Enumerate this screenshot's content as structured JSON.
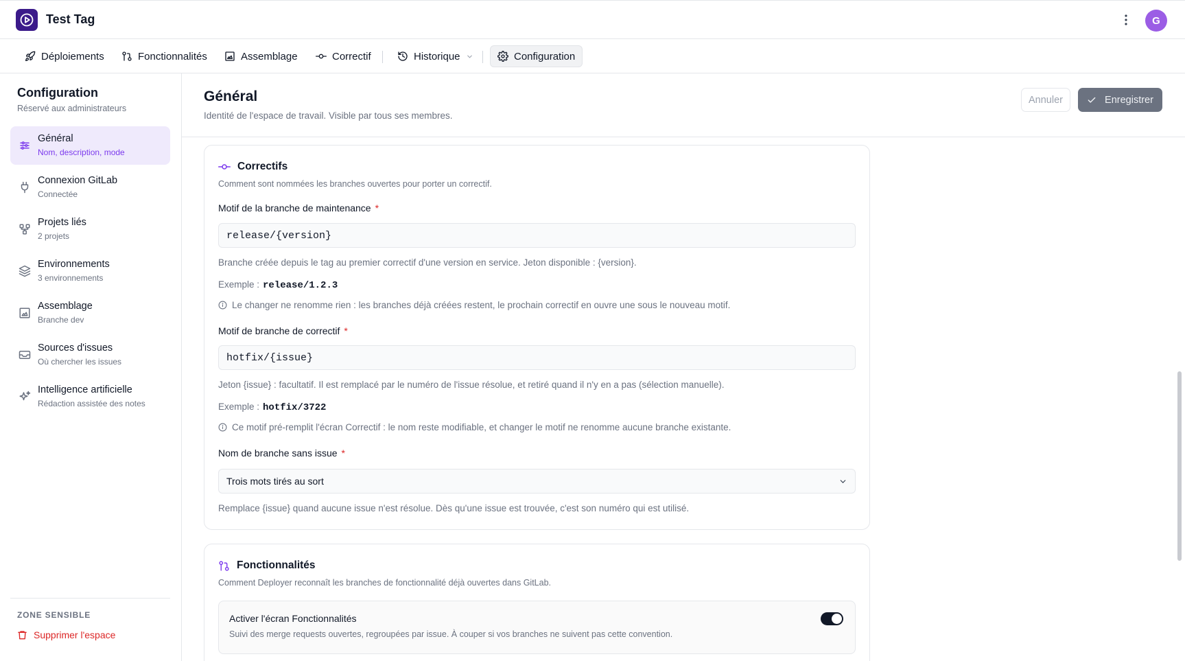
{
  "app": {
    "title": "Test Tag"
  },
  "user": {
    "avatar_initial": "G",
    "avatar_color": "#9b5de5"
  },
  "nav": {
    "tabs": [
      {
        "label": "Déploiements",
        "icon": "rocket-icon"
      },
      {
        "label": "Fonctionnalités",
        "icon": "git-pull-request-icon"
      },
      {
        "label": "Assemblage",
        "icon": "frame-icon"
      },
      {
        "label": "Correctif",
        "icon": "git-commit-icon"
      },
      {
        "label": "Historique",
        "icon": "history-icon"
      },
      {
        "label": "Configuration",
        "icon": "gear-icon",
        "active": true
      }
    ]
  },
  "sidebar": {
    "title": "Configuration",
    "subtitle": "Réservé aux administrateurs",
    "items": [
      {
        "label": "Général",
        "desc": "Nom, description, mode",
        "icon": "sliders-icon",
        "active": true
      },
      {
        "label": "Connexion GitLab",
        "desc": "Connectée",
        "icon": "plug-icon"
      },
      {
        "label": "Projets liés",
        "desc": "2 projets",
        "icon": "projects-icon"
      },
      {
        "label": "Environnements",
        "desc": "3 environnements",
        "icon": "layers-icon"
      },
      {
        "label": "Assemblage",
        "desc": "Branche dev",
        "icon": "frame-icon"
      },
      {
        "label": "Sources d'issues",
        "desc": "Où chercher les issues",
        "icon": "inbox-icon"
      },
      {
        "label": "Intelligence artificielle",
        "desc": "Rédaction assistée des notes",
        "icon": "sparkles-icon"
      }
    ],
    "danger": {
      "title": "ZONE SENSIBLE",
      "action": "Supprimer l'espace"
    }
  },
  "main": {
    "title": "Général",
    "subtitle": "Identité de l'espace de travail. Visible par tous ses membres.",
    "cancel_label": "Annuler",
    "save_label": "Enregistrer"
  },
  "correctifs": {
    "title": "Correctifs",
    "desc": "Comment sont nommées les branches ouvertes pour porter un correctif.",
    "maintenance": {
      "label": "Motif de la branche de maintenance",
      "required": "*",
      "value": "release/{version}",
      "help": "Branche créée depuis le tag au premier correctif d'une version en service. Jeton disponible : {version}.",
      "example_prefix": "Exemple :",
      "example_value": "release/1.2.3",
      "note": "Le changer ne renomme rien : les branches déjà créées restent, le prochain correctif en ouvre une sous le nouveau motif."
    },
    "hotfix": {
      "label": "Motif de branche de correctif",
      "required": "*",
      "value": "hotfix/{issue}",
      "help": "Jeton {issue} : facultatif. Il est remplacé par le numéro de l'issue résolue, et retiré quand il n'y en a pas (sélection manuelle).",
      "example_prefix": "Exemple :",
      "example_value": "hotfix/3722",
      "note": "Ce motif pré-remplit l'écran Correctif : le nom reste modifiable, et changer le motif ne renomme aucune branche existante."
    },
    "no_issue": {
      "label": "Nom de branche sans issue",
      "required": "*",
      "selected": "Trois mots tirés au sort",
      "help": "Remplace {issue} quand aucune issue n'est résolue. Dès qu'une issue est trouvée, c'est son numéro qui est utilisé."
    }
  },
  "fonctionnalites": {
    "title": "Fonctionnalités",
    "desc": "Comment Deployer reconnaît les branches de fonctionnalité déjà ouvertes dans GitLab.",
    "toggle": {
      "label": "Activer l'écran Fonctionnalités",
      "desc": "Suivi des merge requests ouvertes, regroupées par issue. À couper si vos branches ne suivent pas cette convention.",
      "enabled": true
    }
  },
  "colors": {
    "accent": "#7c3aed",
    "danger": "#dc2626",
    "logo_bg": "#3b1a8a"
  }
}
